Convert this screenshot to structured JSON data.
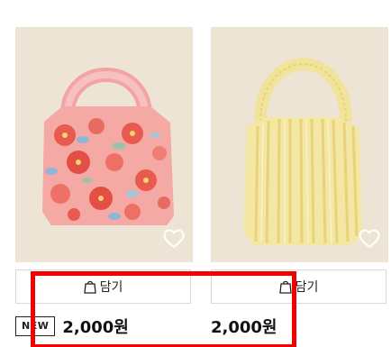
{
  "products": [
    {
      "badge": "NEW",
      "cart_label": "담기",
      "price": "2,000원",
      "icons": {
        "wish": "heart-outline-icon",
        "cart": "shopping-bag-icon"
      }
    },
    {
      "badge": "",
      "cart_label": "담기",
      "price": "2,000원",
      "icons": {
        "wish": "heart-outline-icon",
        "cart": "shopping-bag-icon"
      }
    }
  ],
  "colors": {
    "highlight": "#f20000",
    "photo_background": "#eee4d6",
    "floral_bag": "#f4a9a4",
    "stripe_bag": "#f3e7a3"
  }
}
